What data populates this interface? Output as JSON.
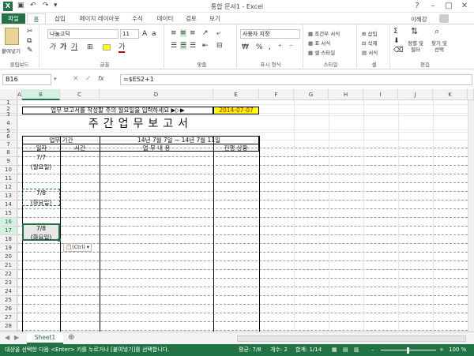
{
  "window": {
    "title": "통합 문서1 - Excel",
    "user": "이혜강"
  },
  "tabs": [
    "파일",
    "홈",
    "삽입",
    "페이지 레이아웃",
    "수식",
    "데이터",
    "검토",
    "보기"
  ],
  "ribbon": {
    "clipboard": {
      "paste": "붙여넣기",
      "label": "클립보드"
    },
    "font": {
      "name": "나눔고딕",
      "size": "11",
      "label": "글꼴",
      "bold": "가",
      "italic": "가",
      "underline": "가"
    },
    "align": {
      "label": "맞춤"
    },
    "number": {
      "format": "사용자 지정",
      "label": "표시 형식"
    },
    "styles": {
      "cond": "조건부 서식",
      "table": "표 서식",
      "cell": "셀 스타일",
      "label": "스타일"
    },
    "cells": {
      "insert": "삽입",
      "delete": "삭제",
      "format": "서식",
      "label": "셀"
    },
    "editing": {
      "sort": "정렬 및 필터",
      "find": "찾기 및 선택",
      "label": "편집"
    }
  },
  "formula_bar": {
    "name_box": "B16",
    "formula": "=$ES2+1",
    "fx": "fx"
  },
  "columns": [
    "A",
    "B",
    "C",
    "D",
    "E",
    "F",
    "G",
    "H",
    "I",
    "J",
    "K"
  ],
  "rows": [
    "1",
    "2",
    "3",
    "4",
    "5",
    "6",
    "7",
    "8",
    "9",
    "10",
    "11",
    "12",
    "13",
    "14",
    "15",
    "16",
    "17",
    "18",
    "19",
    "20",
    "21",
    "22",
    "23",
    "24",
    "25",
    "26",
    "27",
    "28",
    "29",
    "30",
    "31"
  ],
  "sheet": {
    "instruction": "업무 보고서를 작성할 주의 월요일을 입력하세요 ▶▷▶",
    "date": "2014-07-07",
    "title": "주간업무보고서",
    "period_label": "업무 기간",
    "period": "14년 7월 7일 ~ 14년 7월 11일",
    "col_date": "일자",
    "col_time": "시간",
    "col_content": "업 무 내 용",
    "col_status": "진행 상황",
    "entries": [
      {
        "date": "7/7",
        "day": "(월요일)"
      },
      {
        "date": "7/8",
        "day": "(화요일)"
      },
      {
        "date": "7/8",
        "day": "(화요일)"
      }
    ],
    "paste_tag": "(Ctrl)"
  },
  "sheet_tab": "Sheet1",
  "status": {
    "message": "대상을 선택한 다음 <Enter> 키를 누르거나 [붙여넣기]를 선택합니다.",
    "average": "평균: 7/8",
    "count": "개수: 2",
    "sum": "합계: 1/14",
    "zoom": "100 %"
  },
  "colors": {
    "excel_green": "#217346",
    "highlight_yellow": "#ffff00"
  }
}
